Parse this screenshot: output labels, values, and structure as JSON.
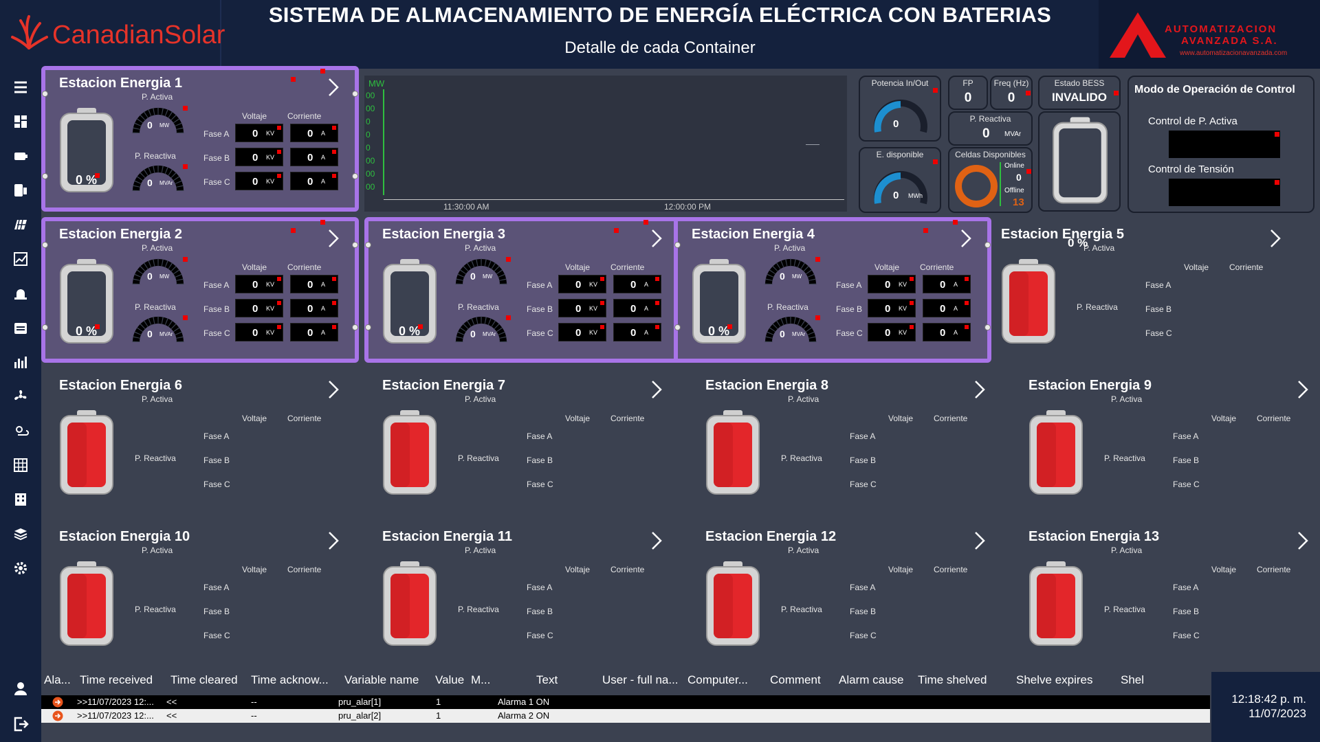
{
  "header": {
    "title": "SISTEMA DE ALMACENAMIENTO DE ENERGÍA ELÉCTRICA CON BATERIAS",
    "subtitle": "Detalle de cada Container",
    "brand_left": "CanadianSolar",
    "brand_right_line1": "AUTOMATIZACION",
    "brand_right_line2": "AVANZADA S.A.",
    "brand_right_url": "www.automatizacionavanzada.com"
  },
  "sidebar": {
    "items": [
      {
        "icon": "menu-icon"
      },
      {
        "icon": "dashboard-icon"
      },
      {
        "icon": "battery-icon"
      },
      {
        "icon": "storage-icon"
      },
      {
        "icon": "panel-icon"
      },
      {
        "icon": "chart-line-icon"
      },
      {
        "icon": "alarm-icon"
      },
      {
        "icon": "calendar-icon"
      },
      {
        "icon": "bar-chart-icon"
      },
      {
        "icon": "fan-icon"
      },
      {
        "icon": "weather-icon"
      },
      {
        "icon": "grid-icon"
      },
      {
        "icon": "building-icon"
      },
      {
        "icon": "module-icon"
      },
      {
        "icon": "gear-icon"
      }
    ],
    "bottom": [
      {
        "icon": "user-icon"
      },
      {
        "icon": "logout-icon"
      }
    ]
  },
  "common": {
    "p_activa": "P. Activa",
    "p_reactiva": "P. Reactiva",
    "voltaje": "Voltaje",
    "corriente": "Corriente",
    "fase_a": "Fase A",
    "fase_b": "Fase B",
    "fase_c": "Fase C",
    "zero": "0",
    "kv": "KV",
    "a": "A",
    "mw": "MW",
    "mvar": "MVAr",
    "pct": "0 %"
  },
  "stations": [
    {
      "title": "Estacion Energia 1",
      "active": true,
      "level_pct": 0
    },
    {
      "title": "Estacion Energia 2",
      "active": true,
      "level_pct": 0
    },
    {
      "title": "Estacion Energia 3",
      "active": true,
      "level_pct": 0
    },
    {
      "title": "Estacion Energia 4",
      "active": true,
      "level_pct": 0
    },
    {
      "title": "Estacion Energia 5",
      "active": false
    },
    {
      "title": "Estacion Energia 6",
      "active": false
    },
    {
      "title": "Estacion Energia 7",
      "active": false
    },
    {
      "title": "Estacion Energia 8",
      "active": false
    },
    {
      "title": "Estacion Energia 9",
      "active": false
    },
    {
      "title": "Estacion Energia 10",
      "active": false
    },
    {
      "title": "Estacion Energia 11",
      "active": false
    },
    {
      "title": "Estacion Energia 12",
      "active": false
    },
    {
      "title": "Estacion Energia 13",
      "active": false
    }
  ],
  "trend": {
    "y_unit": "MW",
    "y_ticks": [
      "00",
      "00",
      "0",
      "0",
      "0",
      "00",
      "00",
      "00"
    ],
    "x_ticks": [
      "11:30:00 AM",
      "12:00:00 PM"
    ]
  },
  "summary": {
    "potencia_label": "Potencia In/Out",
    "potencia_value": "0",
    "fp_label": "FP",
    "fp_value": "0",
    "freq_label": "Freq (Hz)",
    "freq_value": "0",
    "estado_label": "Estado BESS",
    "estado_value": "INVALIDO",
    "preactiva_label": "P. Reactiva",
    "preactiva_value": "0",
    "preactiva_unit": "MVAr",
    "edisp_label": "E. disponible",
    "edisp_value": "0",
    "edisp_unit": "MWh",
    "celdas_label": "Celdas Disponibles",
    "online_label": "Online",
    "online_value": "0",
    "offline_label": "Offline",
    "offline_value": "13"
  },
  "modo": {
    "title": "Modo de Operación de Control",
    "pactiva_label": "Control de P. Activa",
    "tension_label": "Control de Tensión"
  },
  "pct_overlay": "0 %",
  "alarm_table": {
    "columns": [
      "Ala...",
      "Time received",
      "Time cleared",
      "Time acknow...",
      "Variable name",
      "Value",
      "M...",
      "Text",
      "User - full na...",
      "Computer...",
      "Comment",
      "Alarm cause",
      "Time shelved",
      "Shelve expires",
      "Shel"
    ],
    "rows": [
      {
        "received": ">>11/07/2023 12:...",
        "cleared": "<<",
        "ack": "--",
        "variable": "pru_alar[1]",
        "value": "1",
        "text": "Alarma 1 ON"
      },
      {
        "received": ">>11/07/2023 12:...",
        "cleared": "<<",
        "ack": "--",
        "variable": "pru_alar[2]",
        "value": "1",
        "text": "Alarma 2 ON"
      }
    ]
  },
  "clock": {
    "time": "12:18:42 p. m.",
    "date": "11/07/2023"
  }
}
